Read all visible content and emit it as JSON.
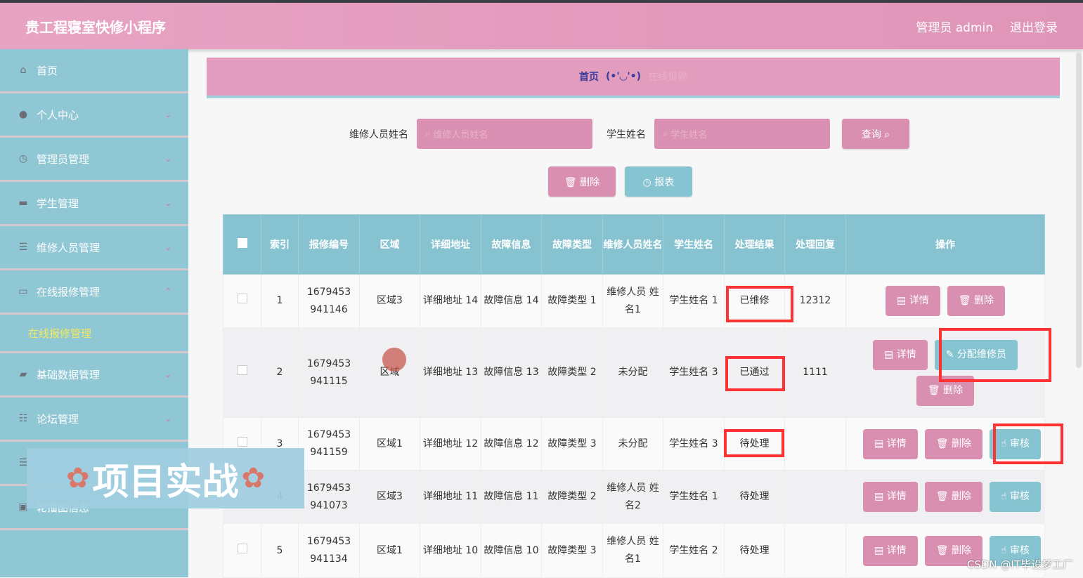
{
  "header": {
    "title": "贵工程寝室快修小程序",
    "user": "管理员 admin",
    "logout": "退出登录"
  },
  "sidebar": {
    "items": [
      {
        "label": "首页",
        "icon": "home-icon",
        "glyph": "⌂",
        "chev": ""
      },
      {
        "label": "个人中心",
        "icon": "user-icon",
        "glyph": "●",
        "chev": "⌄"
      },
      {
        "label": "管理员管理",
        "icon": "clock-icon",
        "glyph": "◷",
        "chev": "⌄"
      },
      {
        "label": "学生管理",
        "icon": "book-icon",
        "glyph": "▬",
        "chev": "⌄"
      },
      {
        "label": "维修人员管理",
        "icon": "list-icon",
        "glyph": "☰",
        "chev": "⌄"
      },
      {
        "label": "在线报修管理",
        "icon": "form-icon",
        "glyph": "▭",
        "chev": "⌃"
      }
    ],
    "sub": "在线报修管理",
    "items2": [
      {
        "label": "基础数据管理",
        "icon": "wallet-icon",
        "glyph": "▰",
        "chev": "⌄"
      },
      {
        "label": "论坛管理",
        "icon": "sliders-icon",
        "glyph": "☷",
        "chev": "⌄"
      },
      {
        "label": "",
        "icon": "list-icon",
        "glyph": "☰",
        "chev": ""
      },
      {
        "label": "轮播图信息",
        "icon": "clipboard-icon",
        "glyph": "▣",
        "chev": ""
      }
    ]
  },
  "breadcrumb": {
    "home": "首页",
    "face": "(•'◡'•)",
    "current": "在线报修"
  },
  "search": {
    "repair_label": "维修人员姓名",
    "repair_placeholder": "维修人员姓名",
    "student_label": "学生姓名",
    "student_placeholder": "学生姓名",
    "query": "查询 ⌕",
    "delete": "🗑 删除",
    "report": "◷ 报表"
  },
  "table": {
    "headers": [
      "",
      "索引",
      "报修编号",
      "区域",
      "详细地址",
      "故障信息",
      "故障类型",
      "维修人员姓名",
      "学生姓名",
      "处理结果",
      "处理回复",
      "操作"
    ],
    "rows": [
      {
        "cells": [
          "1",
          "1679453 941146",
          "区域3",
          "详细地址 14",
          "故障信息 14",
          "故障类型 1",
          "维修人员 姓名1",
          "学生姓名 1",
          "已维修",
          "12312"
        ],
        "ops": [
          [
            "▤ 详情",
            "pink"
          ],
          [
            "🗑 删除",
            "pink"
          ]
        ]
      },
      {
        "cells": [
          "2",
          "1679453 941115",
          "区域",
          "详细地址 13",
          "故障信息 13",
          "故障类型 2",
          "未分配",
          "学生姓名 3",
          "已通过",
          "1111"
        ],
        "ops": [
          [
            "▤ 详情",
            "pink"
          ],
          [
            "✎ 分配维修员",
            "blue"
          ],
          [
            "🗑 删除",
            "pink"
          ]
        ]
      },
      {
        "cells": [
          "3",
          "1679453 941159",
          "区域1",
          "详细地址 12",
          "故障信息 12",
          "故障类型 3",
          "未分配",
          "学生姓名 3",
          "待处理",
          ""
        ],
        "ops": [
          [
            "▤ 详情",
            "pink"
          ],
          [
            "🗑 删除",
            "pink"
          ],
          [
            "☝ 审核",
            "blue"
          ]
        ]
      },
      {
        "cells": [
          "4",
          "1679453 941073",
          "区域3",
          "详细地址 11",
          "故障信息 11",
          "故障类型 2",
          "维修人员 姓名2",
          "学生姓名 1",
          "待处理",
          ""
        ],
        "ops": [
          [
            "▤ 详情",
            "pink"
          ],
          [
            "🗑 删除",
            "pink"
          ],
          [
            "☝ 审核",
            "blue"
          ]
        ]
      },
      {
        "cells": [
          "5",
          "1679453 941134",
          "区域1",
          "详细地址 10",
          "故障信息 10",
          "故障类型 3",
          "维修人员 姓名1",
          "学生姓名 2",
          "待处理",
          ""
        ],
        "ops": [
          [
            "▤ 详情",
            "pink"
          ],
          [
            "🗑 删除",
            "pink"
          ],
          [
            "☝ 审核",
            "blue"
          ]
        ]
      }
    ]
  },
  "overlay": "项目实战",
  "watermark": "CSDN @IT毕设梦工厂",
  "colors": {
    "header": "#e29cbd",
    "sidebar": "#8fc7d4",
    "pink_button": "#d98fb0",
    "blue_button": "#86c4d1",
    "highlight": "#ff3333"
  }
}
